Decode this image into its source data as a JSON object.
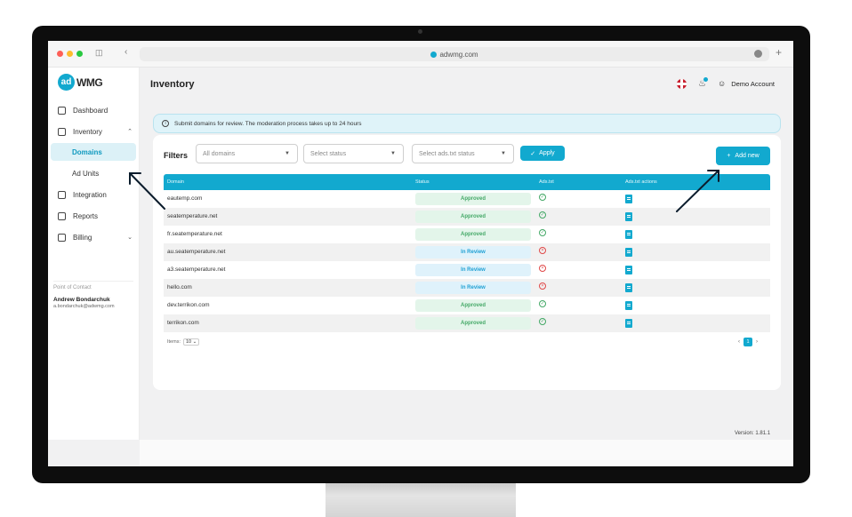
{
  "browser": {
    "url": "adwmg.com"
  },
  "logo": {
    "ad": "ad",
    "wmg": "WMG"
  },
  "header": {
    "title": "Inventory",
    "account": "Demo Account"
  },
  "sidebar": {
    "items": [
      {
        "label": "Dashboard",
        "icon": "home-icon"
      },
      {
        "label": "Inventory",
        "icon": "inventory-icon"
      },
      {
        "label": "Domains",
        "icon": ""
      },
      {
        "label": "Ad Units",
        "icon": ""
      },
      {
        "label": "Integration",
        "icon": "integration-icon"
      },
      {
        "label": "Reports",
        "icon": "reports-icon"
      },
      {
        "label": "Billing",
        "icon": "billing-icon"
      }
    ],
    "contact_heading": "Point of Contact",
    "contact_name": "Andrew Bondarchuk",
    "contact_email": "a.bondarchuk@adwmg.com"
  },
  "banner": {
    "text": "Submit domains for review. The moderation process takes up to 24 hours"
  },
  "filters": {
    "label": "Filters",
    "domains": "All domains",
    "status": "Select status",
    "adstxt": "Select ads.txt status",
    "apply": "Apply",
    "add_new": "Add new"
  },
  "table": {
    "headers": [
      "Domain",
      "Status",
      "Ads.txt",
      "Ads.txt actions"
    ],
    "rows": [
      {
        "domain": "eautemp.com",
        "status": "Approved",
        "adstxt": "ok"
      },
      {
        "domain": "seatemperature.net",
        "status": "Approved",
        "adstxt": "ok"
      },
      {
        "domain": "fr.seatemperature.net",
        "status": "Approved",
        "adstxt": "ok"
      },
      {
        "domain": "au.seatemperature.net",
        "status": "In Review",
        "adstxt": "bad"
      },
      {
        "domain": "a3.seatemperature.net",
        "status": "In Review",
        "adstxt": "bad"
      },
      {
        "domain": "hello.com",
        "status": "In Review",
        "adstxt": "bad"
      },
      {
        "domain": "dev.terrikon.com",
        "status": "Approved",
        "adstxt": "ok"
      },
      {
        "domain": "terrikon.com",
        "status": "Approved",
        "adstxt": "ok"
      }
    ]
  },
  "pagination": {
    "items_label": "Items:",
    "items_value": "10",
    "current_page": "1"
  },
  "footer": {
    "version": "Version: 1.81.1"
  },
  "colors": {
    "accent": "#12a9cf",
    "approved": "#43a866",
    "review": "#1ea0d4",
    "error": "#e04848"
  }
}
